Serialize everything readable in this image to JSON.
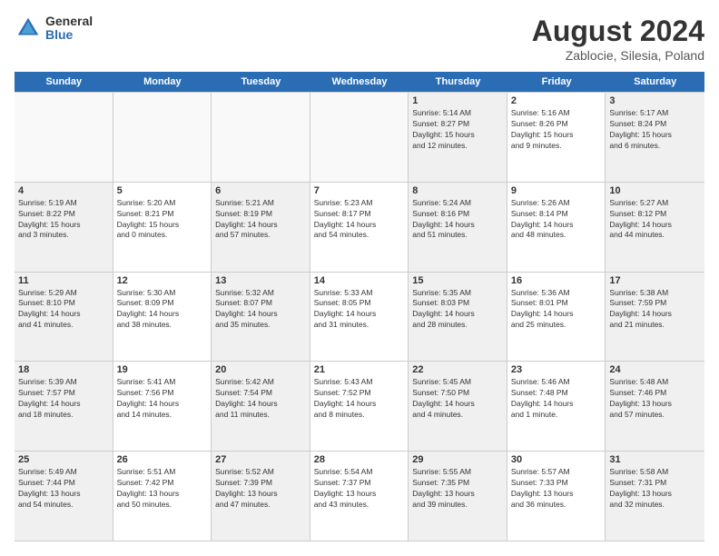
{
  "logo": {
    "general": "General",
    "blue": "Blue"
  },
  "title": "August 2024",
  "subtitle": "Zablocie, Silesia, Poland",
  "days": [
    "Sunday",
    "Monday",
    "Tuesday",
    "Wednesday",
    "Thursday",
    "Friday",
    "Saturday"
  ],
  "weeks": [
    [
      {
        "day": "",
        "info": ""
      },
      {
        "day": "",
        "info": ""
      },
      {
        "day": "",
        "info": ""
      },
      {
        "day": "",
        "info": ""
      },
      {
        "day": "1",
        "info": "Sunrise: 5:14 AM\nSunset: 8:27 PM\nDaylight: 15 hours\nand 12 minutes."
      },
      {
        "day": "2",
        "info": "Sunrise: 5:16 AM\nSunset: 8:26 PM\nDaylight: 15 hours\nand 9 minutes."
      },
      {
        "day": "3",
        "info": "Sunrise: 5:17 AM\nSunset: 8:24 PM\nDaylight: 15 hours\nand 6 minutes."
      }
    ],
    [
      {
        "day": "4",
        "info": "Sunrise: 5:19 AM\nSunset: 8:22 PM\nDaylight: 15 hours\nand 3 minutes."
      },
      {
        "day": "5",
        "info": "Sunrise: 5:20 AM\nSunset: 8:21 PM\nDaylight: 15 hours\nand 0 minutes."
      },
      {
        "day": "6",
        "info": "Sunrise: 5:21 AM\nSunset: 8:19 PM\nDaylight: 14 hours\nand 57 minutes."
      },
      {
        "day": "7",
        "info": "Sunrise: 5:23 AM\nSunset: 8:17 PM\nDaylight: 14 hours\nand 54 minutes."
      },
      {
        "day": "8",
        "info": "Sunrise: 5:24 AM\nSunset: 8:16 PM\nDaylight: 14 hours\nand 51 minutes."
      },
      {
        "day": "9",
        "info": "Sunrise: 5:26 AM\nSunset: 8:14 PM\nDaylight: 14 hours\nand 48 minutes."
      },
      {
        "day": "10",
        "info": "Sunrise: 5:27 AM\nSunset: 8:12 PM\nDaylight: 14 hours\nand 44 minutes."
      }
    ],
    [
      {
        "day": "11",
        "info": "Sunrise: 5:29 AM\nSunset: 8:10 PM\nDaylight: 14 hours\nand 41 minutes."
      },
      {
        "day": "12",
        "info": "Sunrise: 5:30 AM\nSunset: 8:09 PM\nDaylight: 14 hours\nand 38 minutes."
      },
      {
        "day": "13",
        "info": "Sunrise: 5:32 AM\nSunset: 8:07 PM\nDaylight: 14 hours\nand 35 minutes."
      },
      {
        "day": "14",
        "info": "Sunrise: 5:33 AM\nSunset: 8:05 PM\nDaylight: 14 hours\nand 31 minutes."
      },
      {
        "day": "15",
        "info": "Sunrise: 5:35 AM\nSunset: 8:03 PM\nDaylight: 14 hours\nand 28 minutes."
      },
      {
        "day": "16",
        "info": "Sunrise: 5:36 AM\nSunset: 8:01 PM\nDaylight: 14 hours\nand 25 minutes."
      },
      {
        "day": "17",
        "info": "Sunrise: 5:38 AM\nSunset: 7:59 PM\nDaylight: 14 hours\nand 21 minutes."
      }
    ],
    [
      {
        "day": "18",
        "info": "Sunrise: 5:39 AM\nSunset: 7:57 PM\nDaylight: 14 hours\nand 18 minutes."
      },
      {
        "day": "19",
        "info": "Sunrise: 5:41 AM\nSunset: 7:56 PM\nDaylight: 14 hours\nand 14 minutes."
      },
      {
        "day": "20",
        "info": "Sunrise: 5:42 AM\nSunset: 7:54 PM\nDaylight: 14 hours\nand 11 minutes."
      },
      {
        "day": "21",
        "info": "Sunrise: 5:43 AM\nSunset: 7:52 PM\nDaylight: 14 hours\nand 8 minutes."
      },
      {
        "day": "22",
        "info": "Sunrise: 5:45 AM\nSunset: 7:50 PM\nDaylight: 14 hours\nand 4 minutes."
      },
      {
        "day": "23",
        "info": "Sunrise: 5:46 AM\nSunset: 7:48 PM\nDaylight: 14 hours\nand 1 minute."
      },
      {
        "day": "24",
        "info": "Sunrise: 5:48 AM\nSunset: 7:46 PM\nDaylight: 13 hours\nand 57 minutes."
      }
    ],
    [
      {
        "day": "25",
        "info": "Sunrise: 5:49 AM\nSunset: 7:44 PM\nDaylight: 13 hours\nand 54 minutes."
      },
      {
        "day": "26",
        "info": "Sunrise: 5:51 AM\nSunset: 7:42 PM\nDaylight: 13 hours\nand 50 minutes."
      },
      {
        "day": "27",
        "info": "Sunrise: 5:52 AM\nSunset: 7:39 PM\nDaylight: 13 hours\nand 47 minutes."
      },
      {
        "day": "28",
        "info": "Sunrise: 5:54 AM\nSunset: 7:37 PM\nDaylight: 13 hours\nand 43 minutes."
      },
      {
        "day": "29",
        "info": "Sunrise: 5:55 AM\nSunset: 7:35 PM\nDaylight: 13 hours\nand 39 minutes."
      },
      {
        "day": "30",
        "info": "Sunrise: 5:57 AM\nSunset: 7:33 PM\nDaylight: 13 hours\nand 36 minutes."
      },
      {
        "day": "31",
        "info": "Sunrise: 5:58 AM\nSunset: 7:31 PM\nDaylight: 13 hours\nand 32 minutes."
      }
    ]
  ]
}
